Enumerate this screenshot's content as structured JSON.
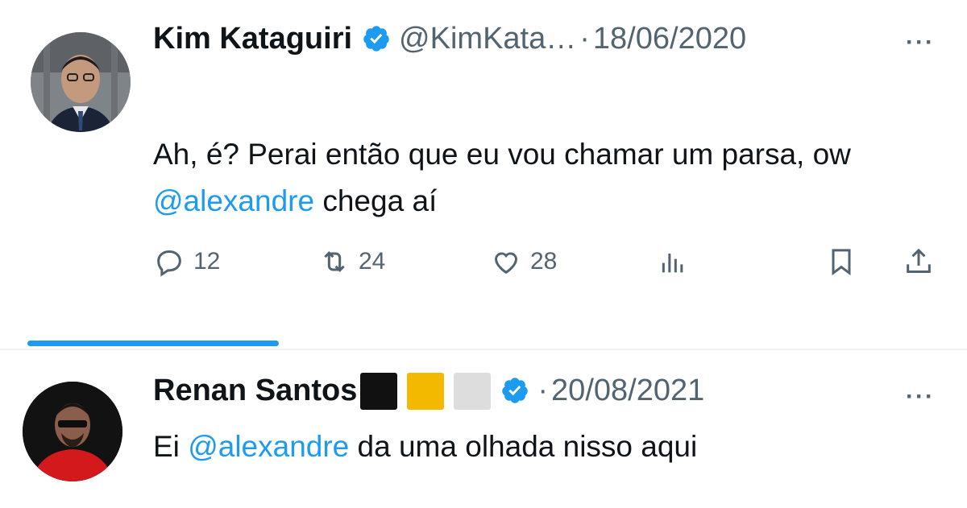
{
  "tweet1": {
    "name": "Kim Kataguiri",
    "handle": "@KimKata…",
    "dot": "·",
    "date": "18/06/2020",
    "text_before": "Ah, é? Perai então que eu vou chamar um parsa, ow ",
    "mention": "@alexandre",
    "text_after": " chega aí",
    "replies": "12",
    "retweets": "24",
    "likes": "28"
  },
  "tweet2": {
    "name": "Renan Santos",
    "flags": [
      {
        "color": "#111111"
      },
      {
        "color": "#f3b800"
      },
      {
        "color": "#dddddd"
      }
    ],
    "dot": "·",
    "date": "20/08/2021",
    "text_before": "Ei ",
    "mention": "@alexandre",
    "text_after": " da uma olhada nisso aqui"
  },
  "colors": {
    "accent": "#1d9bf0",
    "secondary_text": "#536471"
  },
  "icons": {
    "reply": "reply-icon",
    "retweet": "retweet-icon",
    "like": "heart-icon",
    "views": "views-icon",
    "bookmark": "bookmark-icon",
    "share": "share-icon",
    "more": "more-icon",
    "verified": "verified-badge-icon"
  }
}
